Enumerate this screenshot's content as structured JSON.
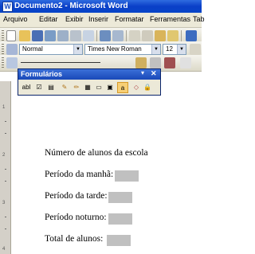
{
  "window": {
    "title": "Documento2 - Microsoft Word",
    "app_icon": "W"
  },
  "menu": [
    "Arquivo",
    "Editar",
    "Exibir",
    "Inserir",
    "Formatar",
    "Ferramentas",
    "Tab"
  ],
  "formatting": {
    "style": "Normal",
    "font": "Times New Roman",
    "size": "12"
  },
  "forms_toolbar": {
    "title": "Formulários",
    "text_field_btn": "abl"
  },
  "ruler_numbers": [
    "1",
    "2",
    "3",
    "4"
  ],
  "document": {
    "heading": "Número de alunos da escola",
    "fields": [
      {
        "label": "Período da manhã:"
      },
      {
        "label": "Período da tarde:"
      },
      {
        "label": "Período noturno:"
      },
      {
        "label": "Total de alunos:"
      }
    ]
  },
  "colors": {
    "titlebar": "#0a3fc7",
    "form_field_shading": "#c0c0c0",
    "chrome": "#ece9d8"
  }
}
